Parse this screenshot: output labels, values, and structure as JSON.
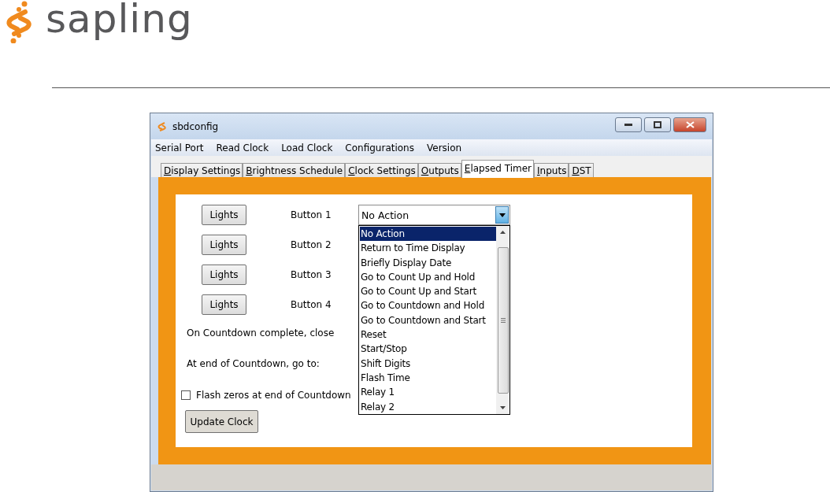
{
  "logo": {
    "text": "sapling"
  },
  "window": {
    "title": "sbdconfig"
  },
  "menu": [
    "Serial Port",
    "Read Clock",
    "Load Clock",
    "Configurations",
    "Version"
  ],
  "tabs": [
    {
      "label": "Display Settings",
      "selected": false
    },
    {
      "label": "Brightness Schedule",
      "selected": false
    },
    {
      "label": "Clock Settings",
      "selected": false
    },
    {
      "label": "Outputs",
      "selected": false
    },
    {
      "label": "Elapsed Timer",
      "selected": true
    },
    {
      "label": "Inputs",
      "selected": false
    },
    {
      "label": "DST",
      "selected": false
    }
  ],
  "button_rows": [
    {
      "action": "Lights",
      "label": "Button 1"
    },
    {
      "action": "Lights",
      "label": "Button 2"
    },
    {
      "action": "Lights",
      "label": "Button 3"
    },
    {
      "action": "Lights",
      "label": "Button 4"
    }
  ],
  "combo": {
    "value": "No Action",
    "options": [
      {
        "label": "No Action",
        "selected": true
      },
      {
        "label": "Return to Time Display",
        "selected": false
      },
      {
        "label": "Briefly Display Date",
        "selected": false
      },
      {
        "label": "Go to Count Up and Hold",
        "selected": false
      },
      {
        "label": "Go to Count Up and Start",
        "selected": false
      },
      {
        "label": "Go to Countdown and Hold",
        "selected": false
      },
      {
        "label": "Go to Countdown and Start",
        "selected": false
      },
      {
        "label": "Reset",
        "selected": false
      },
      {
        "label": "Start/Stop",
        "selected": false
      },
      {
        "label": "Shift Digits",
        "selected": false
      },
      {
        "label": "Flash Time",
        "selected": false
      },
      {
        "label": "Relay 1",
        "selected": false
      },
      {
        "label": "Relay 2",
        "selected": false
      }
    ]
  },
  "labels": [
    "On Countdown complete, close",
    "At end of Countdown, go to:"
  ],
  "flash_zeros": {
    "label": "Flash zeros at end of Countdown",
    "checked": false
  },
  "update_button": "Update Clock"
}
